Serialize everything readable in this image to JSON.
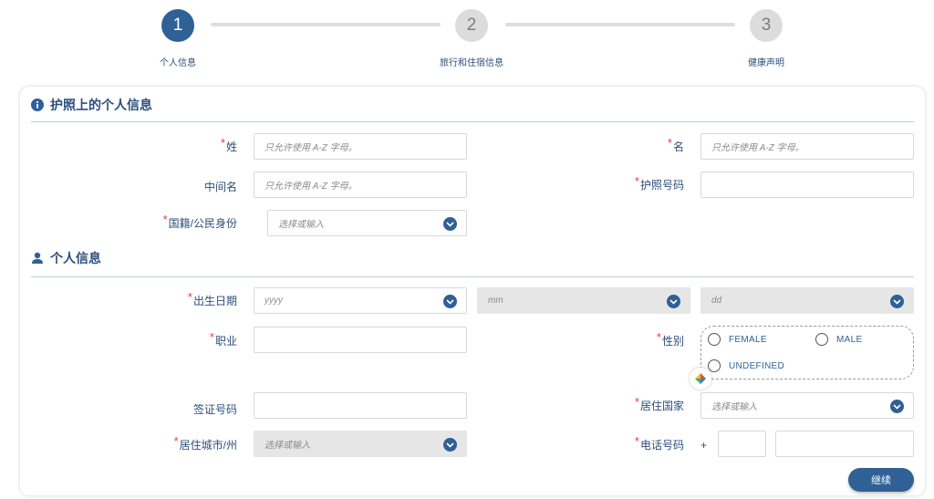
{
  "stepper": {
    "steps": [
      {
        "number": "1",
        "label": "个人信息"
      },
      {
        "number": "2",
        "label": "旅行和住宿信息"
      },
      {
        "number": "3",
        "label": "健康声明"
      }
    ]
  },
  "sections": {
    "passport": {
      "title": "护照上的个人信息",
      "icon": "info-icon"
    },
    "personal": {
      "title": "个人信息",
      "icon": "person-icon"
    }
  },
  "required_mark": "*",
  "form": {
    "surname": {
      "label": "姓",
      "placeholder": "只允许使用 A-Z 字母。",
      "required": true
    },
    "given_name": {
      "label": "名",
      "placeholder": "只允许使用 A-Z 字母。",
      "required": true
    },
    "middle_name": {
      "label": "中间名",
      "placeholder": "只允许使用 A-Z 字母。",
      "required": false
    },
    "passport_number": {
      "label": "护照号码",
      "value": "",
      "required": true
    },
    "nationality": {
      "label": "国籍/公民身份",
      "placeholder": "选择或输入",
      "required": true
    },
    "birth_date": {
      "label": "出生日期",
      "year_placeholder": "yyyy",
      "month_placeholder": "mm",
      "day_placeholder": "dd",
      "required": true
    },
    "occupation": {
      "label": "职业",
      "value": "",
      "required": true
    },
    "gender": {
      "label": "性别",
      "required": true,
      "options": [
        "FEMALE",
        "MALE",
        "UNDEFINED"
      ],
      "selected": null
    },
    "visa_number": {
      "label": "签证号码",
      "value": "",
      "required": false
    },
    "residence_country": {
      "label": "居住国家",
      "placeholder": "选择或输入",
      "required": true
    },
    "residence_city": {
      "label": "居住城市/州",
      "placeholder": "选择或输入",
      "required": true,
      "disabled": true
    },
    "phone": {
      "label": "电话号码",
      "prefix": "+",
      "country_code": "",
      "number": "",
      "required": true
    }
  },
  "actions": {
    "continue_label": "继续"
  },
  "colors": {
    "primary": "#2f6096",
    "text": "#2d4f7c",
    "required": "#e0413f",
    "disabled_bg": "#e6e6e6",
    "inactive_step": "#dcdcdc"
  }
}
